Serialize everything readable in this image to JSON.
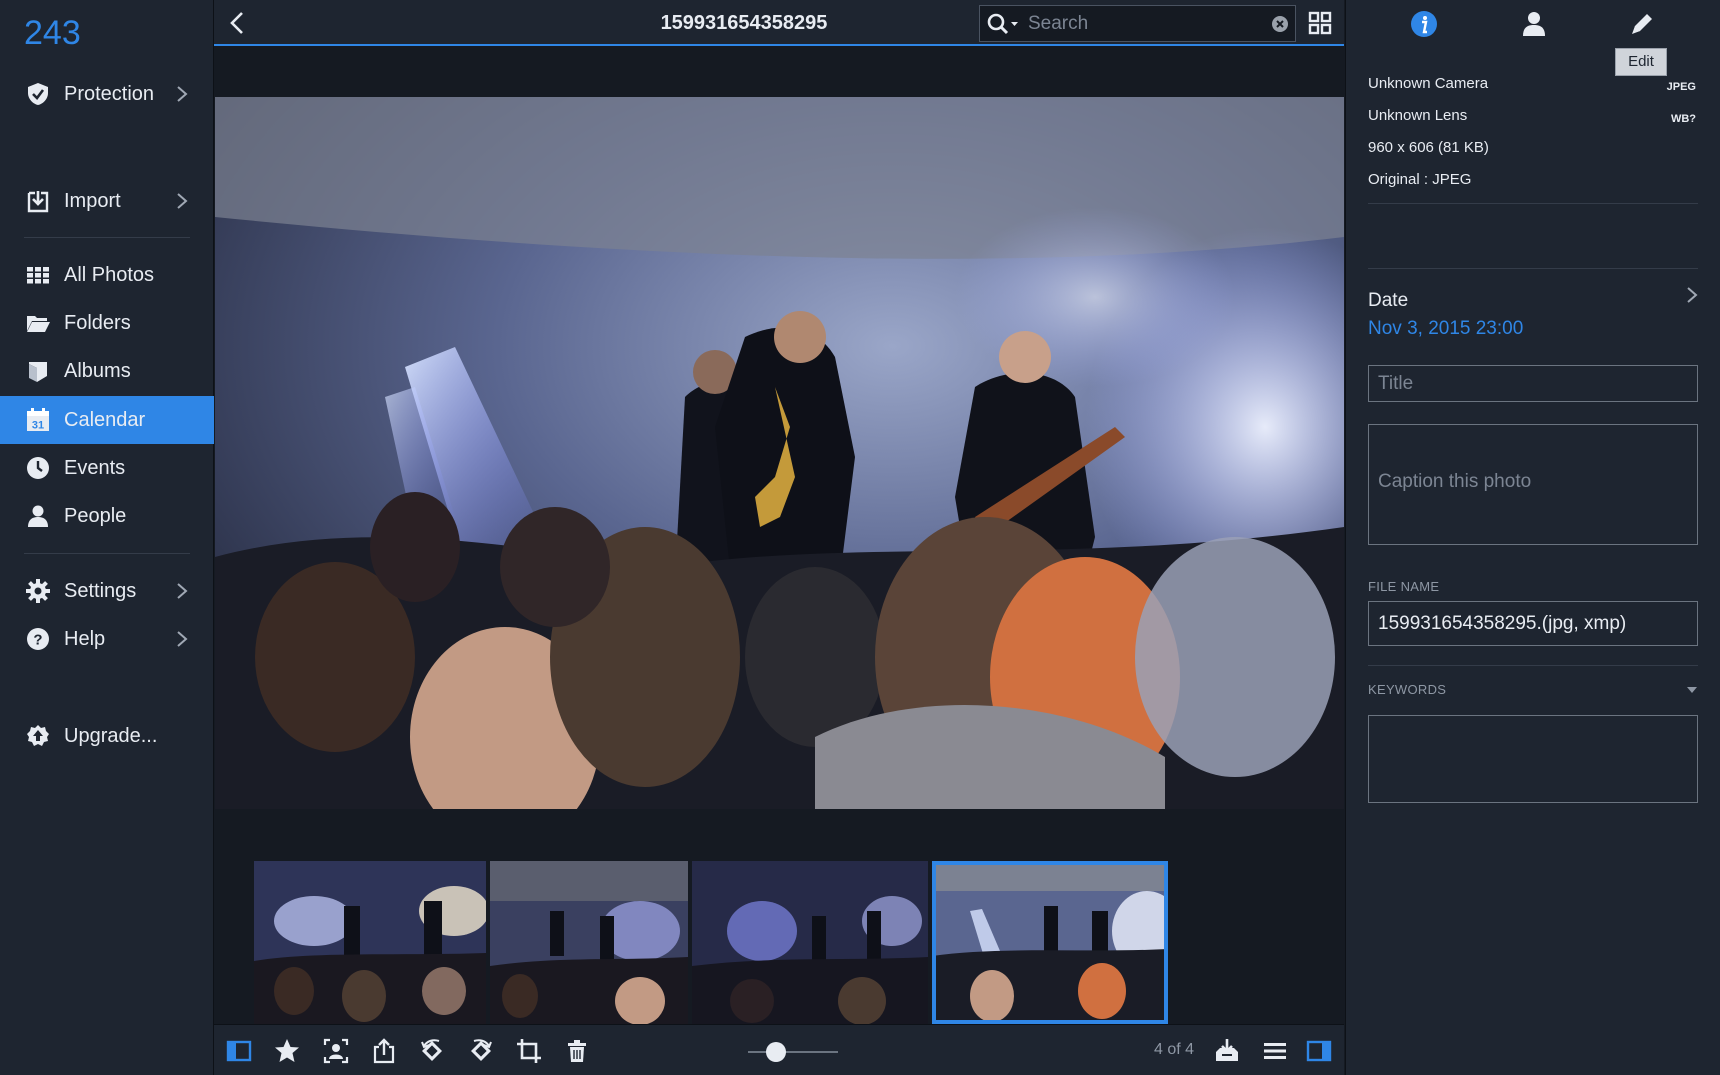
{
  "sidebar": {
    "count": "243",
    "items": [
      {
        "label": "Protection",
        "icon": "shield-icon",
        "has_arrow": true
      },
      {
        "label": "Import",
        "icon": "import-icon",
        "has_arrow": true
      },
      {
        "label": "All Photos",
        "icon": "grid-icon",
        "has_arrow": false
      },
      {
        "label": "Folders",
        "icon": "folder-icon",
        "has_arrow": false
      },
      {
        "label": "Albums",
        "icon": "album-icon",
        "has_arrow": false
      },
      {
        "label": "Calendar",
        "icon": "calendar-icon",
        "has_arrow": false,
        "active": true
      },
      {
        "label": "Events",
        "icon": "clock-icon",
        "has_arrow": false
      },
      {
        "label": "People",
        "icon": "person-icon",
        "has_arrow": false
      },
      {
        "label": "Settings",
        "icon": "gear-icon",
        "has_arrow": true
      },
      {
        "label": "Help",
        "icon": "help-icon",
        "has_arrow": true
      },
      {
        "label": "Upgrade...",
        "icon": "upgrade-icon",
        "has_arrow": false
      }
    ],
    "calendar_icon_day": "31"
  },
  "header": {
    "title": "159931654358295",
    "search_placeholder": "Search"
  },
  "viewer": {
    "position_label": "4 of 4",
    "selected_thumbnail": 4,
    "thumbnail_count": 4
  },
  "toolbar": {
    "buttons": [
      "sidebar-toggle",
      "star",
      "face-detect",
      "share",
      "rotate-left",
      "rotate-right",
      "crop",
      "trash",
      "zoom-slider",
      "import-down",
      "list-menu",
      "panel-toggle"
    ]
  },
  "panel": {
    "tabs": [
      "info-icon",
      "person-icon",
      "pencil-icon"
    ],
    "tooltip": "Edit",
    "camera": "Unknown Camera",
    "lens": "Unknown Lens",
    "dimensions": "960 x 606 (81 KB)",
    "original": "Original : JPEG",
    "badge_format": "JPEG",
    "badge_wb": "WB?",
    "date_label": "Date",
    "date_value": "Nov 3, 2015 23:00",
    "title_placeholder": "Title",
    "caption_placeholder": "Caption this photo",
    "file_name_label": "FILE NAME",
    "file_name_value": "159931654358295.(jpg, xmp)",
    "keywords_label": "KEYWORDS"
  },
  "colors": {
    "accent": "#2f86e6",
    "sidebar_bg": "#1e2530",
    "canvas_bg": "#151a22"
  }
}
